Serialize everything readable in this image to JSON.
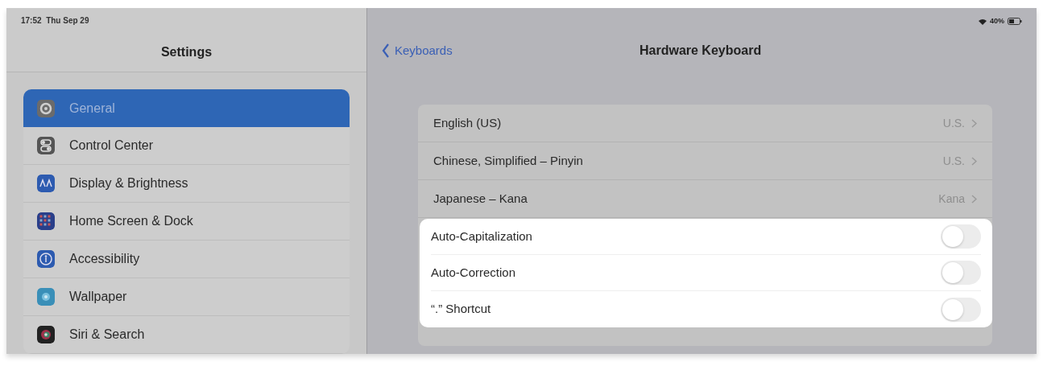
{
  "sidebar": {
    "status_time": "17:52  Thu Sep 29",
    "title": "Settings",
    "items": [
      {
        "label": "General",
        "selected": true
      },
      {
        "label": "Control Center",
        "selected": false
      },
      {
        "label": "Display & Brightness",
        "selected": false
      },
      {
        "label": "Home Screen & Dock",
        "selected": false
      },
      {
        "label": "Accessibility",
        "selected": false
      },
      {
        "label": "Wallpaper",
        "selected": false
      },
      {
        "label": "Siri & Search",
        "selected": false
      }
    ]
  },
  "detail": {
    "battery_text": "40%",
    "back_label": "Keyboards",
    "title": "Hardware Keyboard",
    "keyboards": [
      {
        "name": "English (US)",
        "value": "U.S."
      },
      {
        "name": "Chinese, Simplified – Pinyin",
        "value": "U.S."
      },
      {
        "name": "Japanese – Kana",
        "value": "Kana"
      }
    ]
  },
  "popup": {
    "rows": [
      {
        "label": "Auto-Capitalization",
        "on": false
      },
      {
        "label": "Auto-Correction",
        "on": false
      },
      {
        "label": "“.” Shortcut",
        "on": false
      }
    ]
  }
}
